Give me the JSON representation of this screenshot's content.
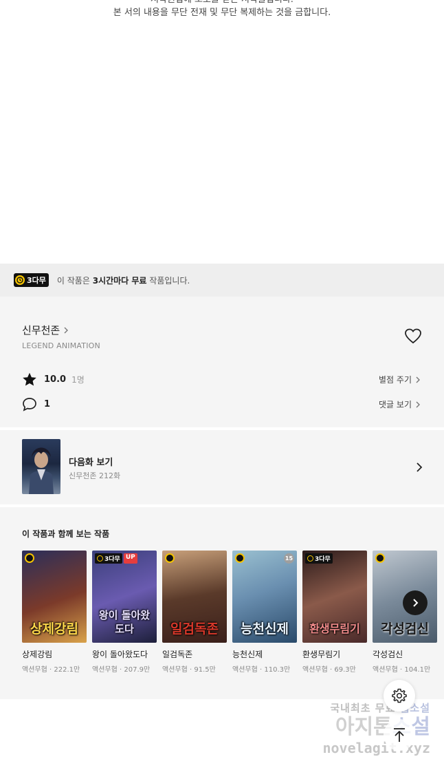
{
  "copyright": {
    "line1": "저작권법에 보호를 받는 저작물입니다.",
    "line2": "본 서의 내용을 무단 전재 및 무단 복제하는 것을 금합니다."
  },
  "free_bar": {
    "badge": "3다무",
    "text_prefix": "이 작품은 ",
    "text_bold": "3시간마다 무료",
    "text_suffix": " 작품입니다."
  },
  "series": {
    "title": "신무천존",
    "author": "LEGEND ANIMATION",
    "rating": "10.0",
    "rating_count": "1명",
    "rate_label": "별점 주기",
    "comment_count": "1",
    "comment_label": "댓글 보기"
  },
  "next_episode": {
    "label": "다음화 보기",
    "subtitle": "신무천존 212화"
  },
  "recommendations": {
    "heading": "이 작품과 함께 보는 작품",
    "items": [
      {
        "name": "상제강림",
        "genre": "액션무협",
        "views": "222.1만",
        "cover_text": "상제강림",
        "badge": "clock",
        "colors": [
          "#2b2f5a",
          "#7b3a2a",
          "#d9a24a"
        ]
      },
      {
        "name": "왕이 돌아왔도다",
        "genre": "액션무협",
        "views": "207.9만",
        "cover_text": "왕이 돌아왔도다",
        "badge": "3다무",
        "up": "UP",
        "colors": [
          "#3a3f7a",
          "#6a5bb0",
          "#1d1f3a"
        ]
      },
      {
        "name": "일검독존",
        "genre": "액션무협",
        "views": "91.5만",
        "cover_text": "일검독존",
        "badge": "clock",
        "colors": [
          "#5a3a2a",
          "#c8a07a",
          "#3a1f1a"
        ]
      },
      {
        "name": "능천신제",
        "genre": "액션무협",
        "views": "110.3만",
        "cover_text": "능천신제",
        "badge": "clock",
        "age": "15",
        "colors": [
          "#6a8fb0",
          "#2a4a6a",
          "#9ac0d0"
        ]
      },
      {
        "name": "환생무림기",
        "genre": "액션무협",
        "views": "69.3만",
        "cover_text": "환생무림기",
        "badge": "3다무",
        "colors": [
          "#4a2a2a",
          "#8a5a4a",
          "#2a1a1a"
        ]
      },
      {
        "name": "각성검신",
        "genre": "액션무협",
        "views": "104.1만",
        "cover_text": "각성검신",
        "badge": "clock",
        "colors": [
          "#7a8a9a",
          "#c0c8d0",
          "#4a5a6a"
        ]
      }
    ]
  },
  "watermark": {
    "line1_a": "국내최초 무료 ",
    "line1_b": "웹소설",
    "line2_a": "아지톤",
    "line2_b": "소설",
    "line3": "novelagit.xyz"
  },
  "colors": {
    "accent_yellow": "#f5c400",
    "up_red": "#e63d3d",
    "panel_bg": "#f5f5f5"
  }
}
